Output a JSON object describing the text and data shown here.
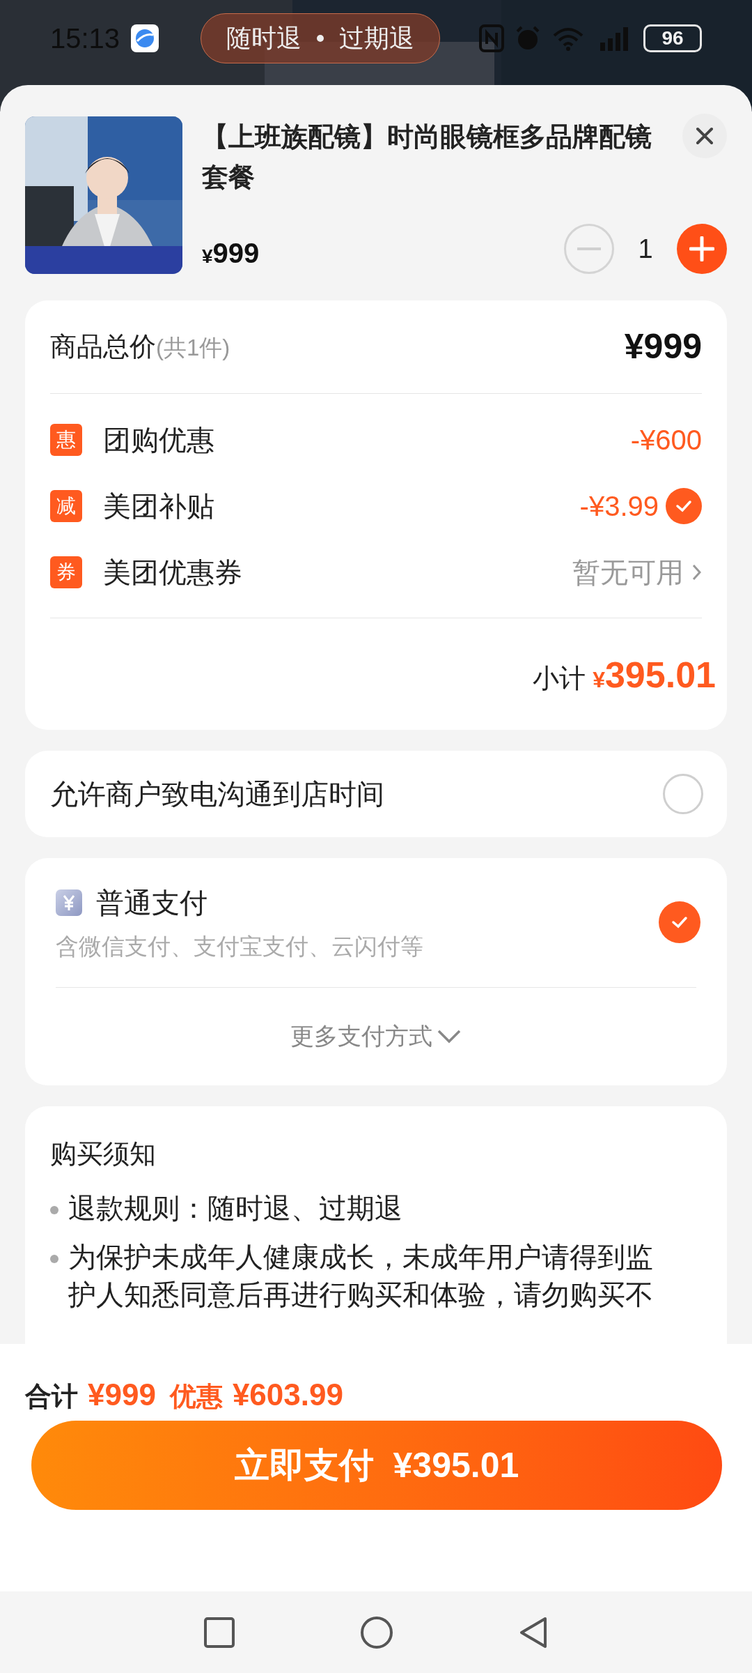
{
  "status_bar": {
    "time": "15:13",
    "battery": "96"
  },
  "refund_pill": [
    "随时退",
    "过期退"
  ],
  "product": {
    "title": "【上班族配镜】时尚眼镜框多品牌配镜套餐",
    "currency": "¥",
    "price": "999",
    "quantity": "1"
  },
  "summary": {
    "label": "商品总价",
    "count": "(共1件)",
    "total": "¥999"
  },
  "discounts": [
    {
      "kind": "amount",
      "badge": "惠",
      "label": "团购优惠",
      "value": "-¥600"
    },
    {
      "kind": "toggle",
      "badge": "减",
      "label": "美团补贴",
      "value": "-¥3.99",
      "checked": true
    },
    {
      "kind": "link",
      "badge": "券",
      "label": "美团优惠券",
      "value": "暂无可用"
    }
  ],
  "subtotal": {
    "label": "小计",
    "currency": "¥",
    "amount": "395.01"
  },
  "contact_option": {
    "label": "允许商户致电沟通到店时间",
    "checked": false
  },
  "payment": {
    "title": "普通支付",
    "subtitle": "含微信支付、支付宝支付、云闪付等",
    "selected": true,
    "more": "更多支付方式"
  },
  "notice": {
    "title": "购买须知",
    "items": [
      "退款规则：随时退、过期退",
      "为保护未成年人健康成长，未成年用户请得到监护人知悉同意后再进行购买和体验，请勿购买不"
    ]
  },
  "footer": {
    "total_label": "合计",
    "total": "¥999",
    "discount_label": "优惠",
    "discount": "¥603.99",
    "pay_button": "立即支付  ¥395.01"
  }
}
